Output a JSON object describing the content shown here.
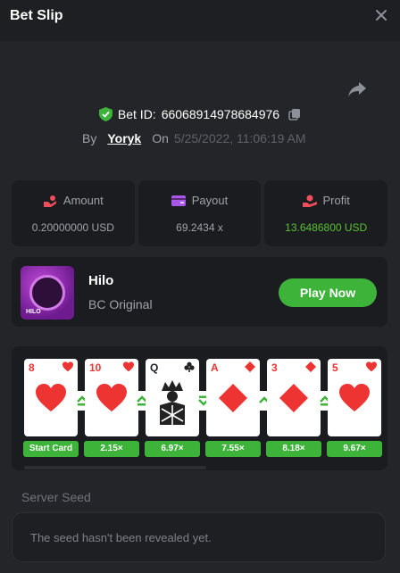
{
  "header": {
    "title": "Bet Slip"
  },
  "bet": {
    "id_label": "Bet ID:",
    "id_value": "66068914978684976",
    "by_label": "By",
    "user": "Yoryk",
    "on_label": "On",
    "date": "5/25/2022, 11:06:19 AM"
  },
  "stats": [
    {
      "label": "Amount",
      "value": "0.20000000 USD"
    },
    {
      "label": "Payout",
      "value": "69.2434 x"
    },
    {
      "label": "Profit",
      "value": "13.6486800 USD"
    }
  ],
  "colors": {
    "accent_green": "#3db33a",
    "profit_green": "#58c132",
    "amount_icon": "#ef4e5a",
    "payout_icon": "#a957e8",
    "profit_icon": "#ef4e5a"
  },
  "game": {
    "name": "Hilo",
    "subtitle": "BC Original",
    "play_label": "Play Now",
    "thumb_text": "HILO"
  },
  "cards": [
    {
      "rank": "8",
      "suit": "heart",
      "label": "Start Card"
    },
    {
      "rank": "10",
      "suit": "heart",
      "label": "2.15×"
    },
    {
      "rank": "Q",
      "suit": "club",
      "label": "6.97×"
    },
    {
      "rank": "A",
      "suit": "diamond",
      "label": "7.55×"
    },
    {
      "rank": "3",
      "suit": "diamond",
      "label": "8.18×"
    },
    {
      "rank": "5",
      "suit": "heart",
      "label": "9.67×"
    }
  ],
  "arrows": [
    "higher-equal",
    "higher-equal",
    "lower-equal",
    "higher",
    "higher-equal"
  ],
  "seed": {
    "label": "Server Seed",
    "value": "The seed hasn't been revealed yet."
  }
}
